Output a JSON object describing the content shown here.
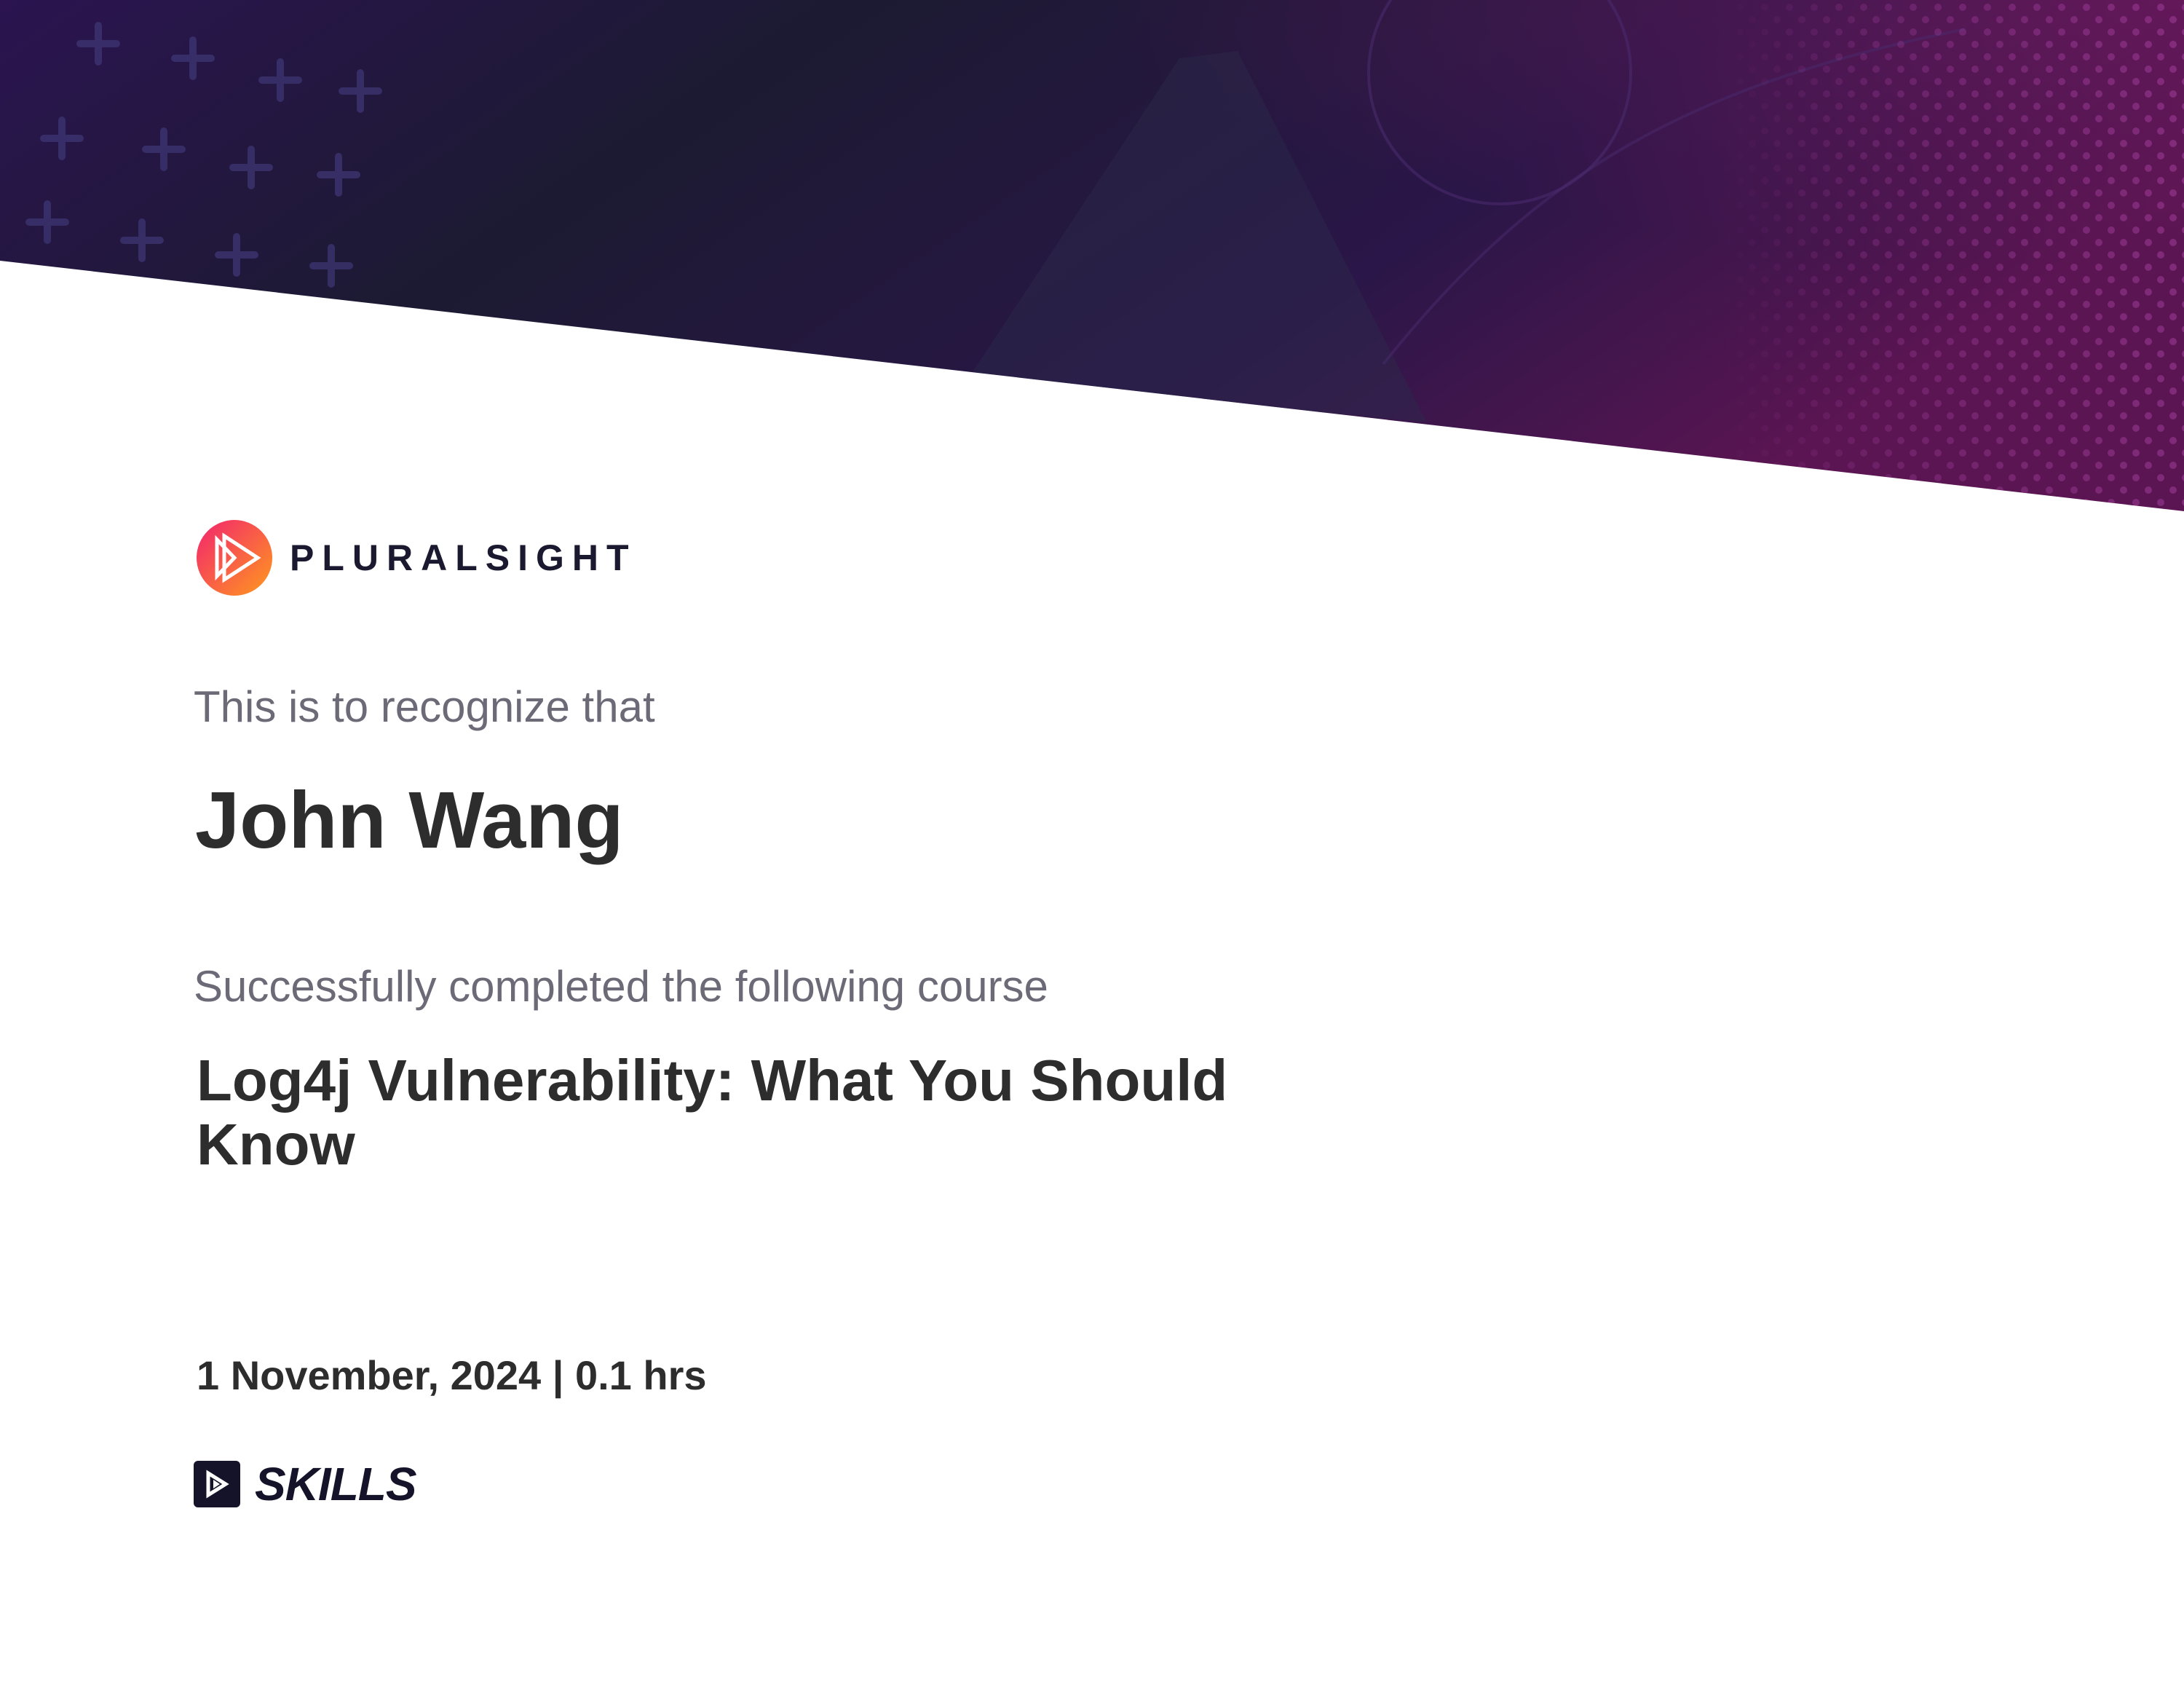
{
  "brand": {
    "name": "PLURALSIGHT",
    "logo_icon": "pluralsight-play-icon",
    "gradient_start": "#f2236f",
    "gradient_end": "#ff9a1d",
    "text_color": "#1a1930"
  },
  "banner": {
    "color_dark": "#1c1a32",
    "color_purple": "#2b1450",
    "color_magenta": "#5a1552"
  },
  "certificate": {
    "intro": "This is to recognize that",
    "recipient": "John Wang",
    "completed_text": "Successfully completed the following course",
    "course_title": "Log4j Vulnerability: What You Should Know",
    "date_duration": "1 November, 2024 | 0.1 hrs"
  },
  "product": {
    "name": "SKILLS",
    "icon": "skills-play-icon",
    "color": "#14132a"
  }
}
